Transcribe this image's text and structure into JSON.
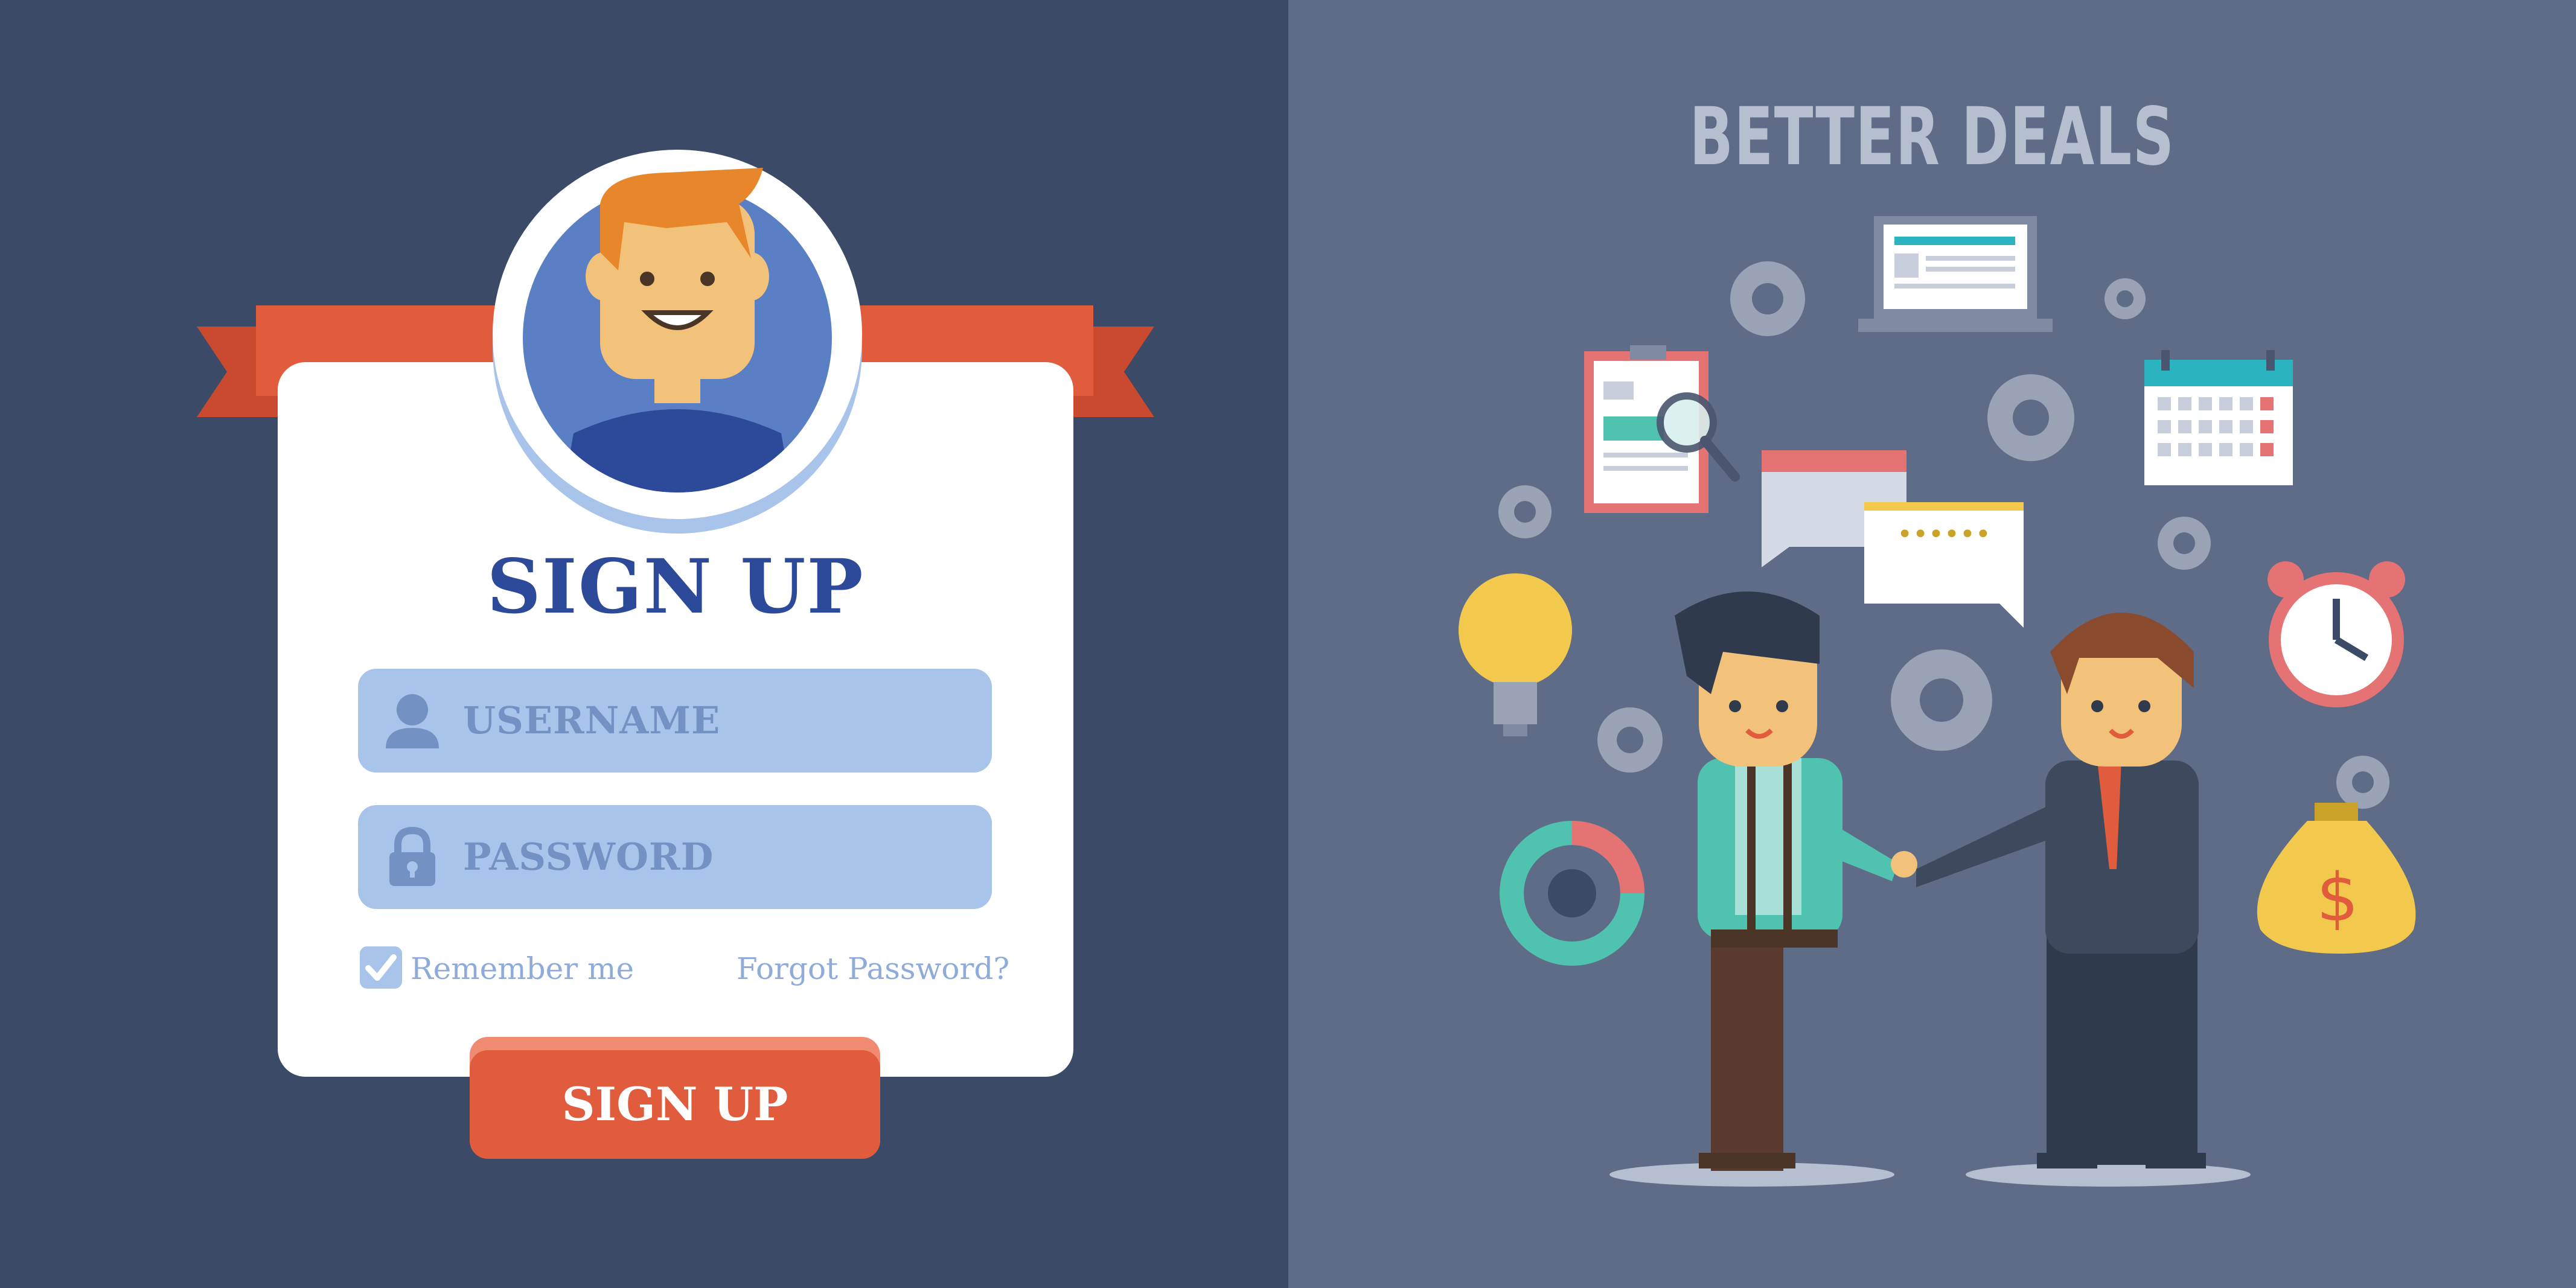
{
  "form": {
    "title": "SIGN UP",
    "username_placeholder": "USERNAME",
    "password_placeholder": "PASSWORD",
    "remember_label": "Remember me",
    "remember_checked": true,
    "forgot_label": "Forgot Password?",
    "submit_label": "SIGN UP"
  },
  "illustration": {
    "heading": "BETTER DEALS",
    "password_bubble": "••••••"
  },
  "colors": {
    "left_background": "#3b4a66",
    "right_background": "#5f6c87",
    "accent": "#e05c3c",
    "title": "#2d4a9a",
    "field": "#a8c4eb"
  }
}
